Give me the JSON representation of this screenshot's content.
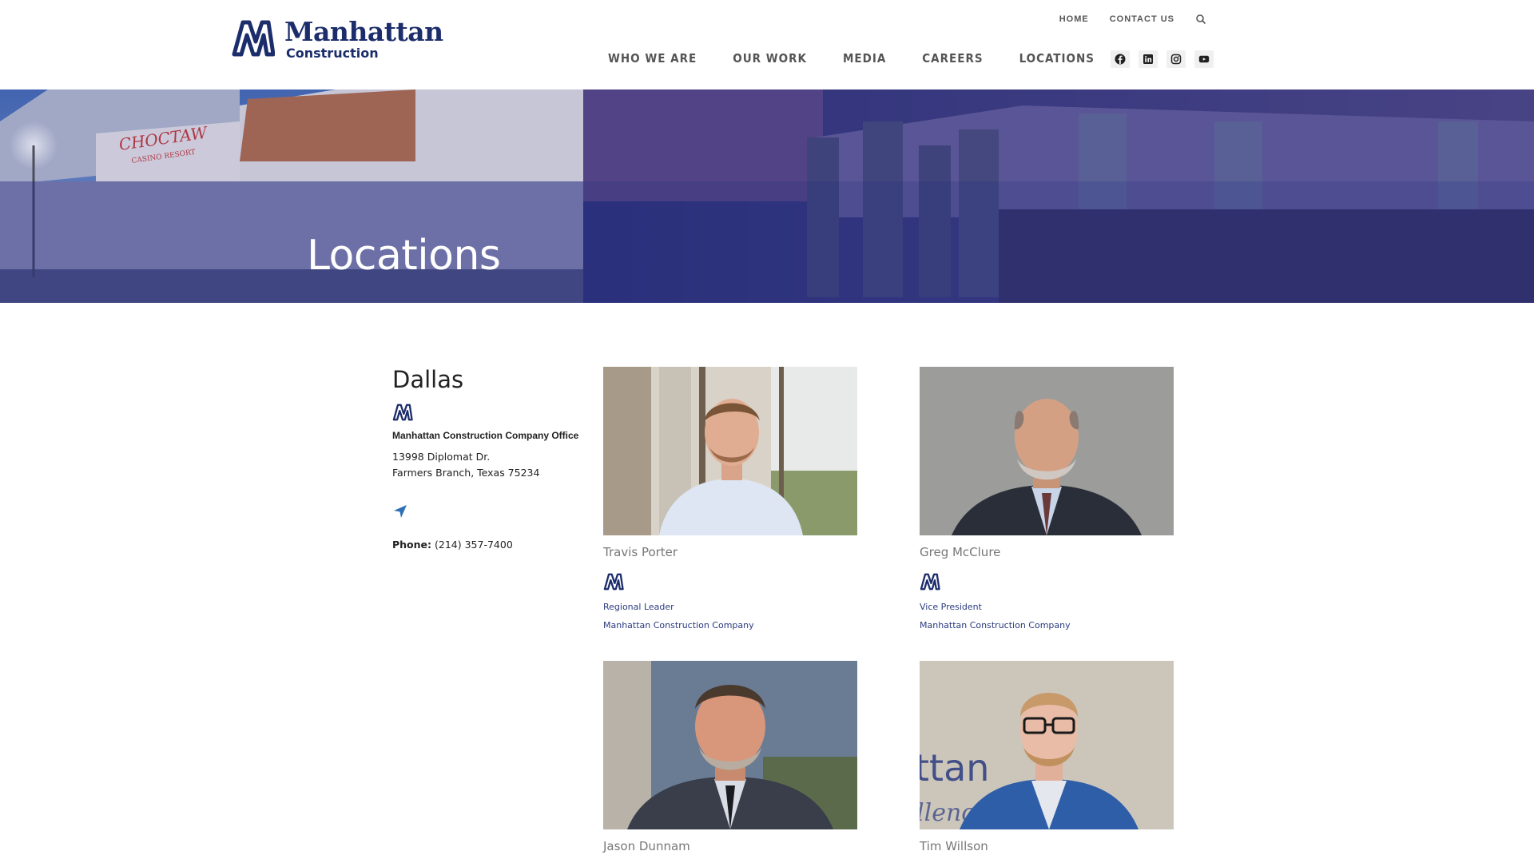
{
  "brand": {
    "name": "Manhattan",
    "tagline": "Construction",
    "color": "#1c2d6b"
  },
  "utility_nav": {
    "home": "HOME",
    "contact": "CONTACT US",
    "search_icon": "search-icon"
  },
  "main_nav": [
    "WHO WE ARE",
    "OUR WORK",
    "MEDIA",
    "CAREERS",
    "LOCATIONS"
  ],
  "social": [
    "facebook-icon",
    "linkedin-icon",
    "instagram-icon",
    "youtube-icon"
  ],
  "hero": {
    "title": "Locations",
    "sign_text": "CHOCTAW",
    "sign_sub": "CASINO RESORT",
    "overlay_color": "#1e2880"
  },
  "office": {
    "city": "Dallas",
    "name": "Manhattan Construction Company Office",
    "address_line1": "13998 Diplomat Dr.",
    "address_line2": "Farmers Branch, Texas 75234",
    "phone_label": "Phone:",
    "phone": "(214) 357-7400"
  },
  "team": [
    {
      "name": "Travis Porter",
      "title": "Regional Leader",
      "company": "Manhattan Construction Company"
    },
    {
      "name": "Greg McClure",
      "title": "Vice President",
      "company": "Manhattan Construction Company"
    },
    {
      "name": "Jason Dunnam"
    },
    {
      "name": "Tim Willson",
      "backdrop_text": "ttan",
      "backdrop_text2": "llenc"
    }
  ]
}
